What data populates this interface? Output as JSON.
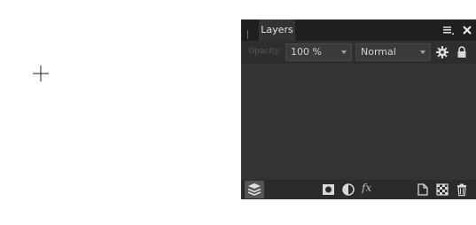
{
  "crosshair": {
    "icon": "crosshair-icon"
  },
  "panel": {
    "tab_label": "Layers",
    "icons": {
      "grip": "grip-icon",
      "menu": "panel-menu-icon",
      "close": "close-icon"
    }
  },
  "toolbar": {
    "opacity_label": "Opacity:",
    "opacity_value": "100 %",
    "blend_mode_value": "Normal",
    "icons": {
      "settings": "gear-icon",
      "lock": "lock-icon"
    }
  },
  "footer": {
    "fx_label": "fx",
    "icons": [
      "layers-stack-icon",
      "mask-icon",
      "adjustment-icon",
      "fx-icon",
      "new-layer-icon",
      "checkerboard-icon",
      "trash-icon"
    ]
  },
  "colors": {
    "panel_bg": "#333333",
    "titlebar_bg": "#1f1f1f",
    "text": "#e6e6e6"
  }
}
